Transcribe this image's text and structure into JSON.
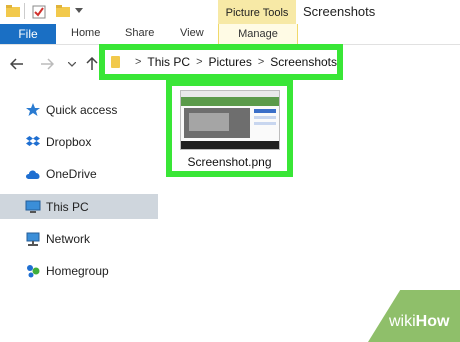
{
  "window": {
    "title": "Screenshots",
    "context_tab": "Picture Tools"
  },
  "ribbon": {
    "tabs": [
      "File",
      "Home",
      "Share",
      "View",
      "Manage"
    ]
  },
  "address_bar": {
    "path": [
      "This PC",
      "Pictures",
      "Screenshots"
    ]
  },
  "sidebar": {
    "items": [
      {
        "label": "Quick access",
        "icon": "star-icon"
      },
      {
        "label": "Dropbox",
        "icon": "dropbox-icon"
      },
      {
        "label": "OneDrive",
        "icon": "cloud-icon"
      },
      {
        "label": "This PC",
        "icon": "computer-icon",
        "selected": true
      },
      {
        "label": "Network",
        "icon": "network-icon"
      },
      {
        "label": "Homegroup",
        "icon": "homegroup-icon"
      }
    ]
  },
  "files": [
    {
      "name": "Screenshot.png",
      "type": "image"
    }
  ],
  "colors": {
    "highlight": "#39e636",
    "file_tab": "#1a6fc4",
    "picture_tools": "#f7e9a6"
  },
  "watermark": {
    "text": "wikiHow"
  }
}
